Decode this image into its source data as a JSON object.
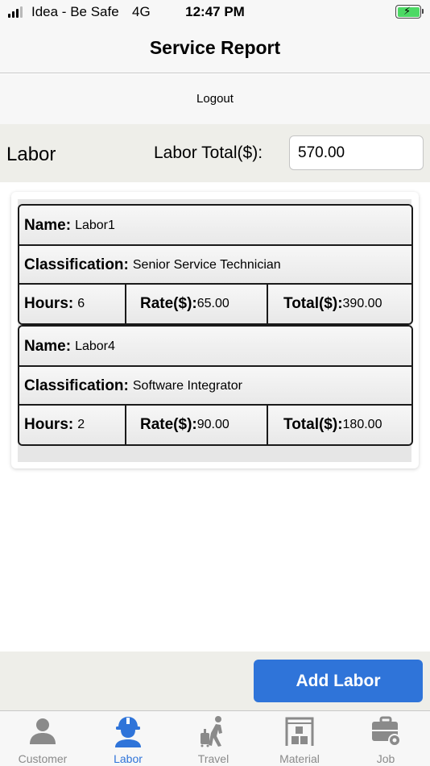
{
  "status_bar": {
    "carrier": "Idea - Be Safe",
    "network": "4G",
    "time": "12:47 PM"
  },
  "nav": {
    "title": "Service Report"
  },
  "logout_label": "Logout",
  "labor_header": {
    "title": "Labor",
    "total_label": "Labor Total($):",
    "total_value": "570.00"
  },
  "labor_items": [
    {
      "name_label": "Name:",
      "name": "Labor1",
      "classification_label": "Classification:",
      "classification": "Senior Service Technician",
      "hours_label": "Hours:",
      "hours": "6",
      "rate_label": "Rate($):",
      "rate": "65.00",
      "total_label": "Total($):",
      "total": "390.00"
    },
    {
      "name_label": "Name:",
      "name": "Labor4",
      "classification_label": "Classification:",
      "classification": "Software Integrator",
      "hours_label": "Hours:",
      "hours": "2",
      "rate_label": "Rate($):",
      "rate": "90.00",
      "total_label": "Total($):",
      "total": "180.00"
    }
  ],
  "add_button_label": "Add Labor",
  "tabs": [
    {
      "label": "Customer",
      "icon": "person-icon"
    },
    {
      "label": "Labor",
      "icon": "hard-hat-worker-icon"
    },
    {
      "label": "Travel",
      "icon": "walking-luggage-icon"
    },
    {
      "label": "Material",
      "icon": "warehouse-boxes-icon"
    },
    {
      "label": "Job",
      "icon": "briefcase-gear-icon"
    }
  ],
  "active_tab": "Labor",
  "colors": {
    "accent": "#2f74d9",
    "tab_inactive": "#8a8a8a",
    "battery": "#4cd964"
  }
}
